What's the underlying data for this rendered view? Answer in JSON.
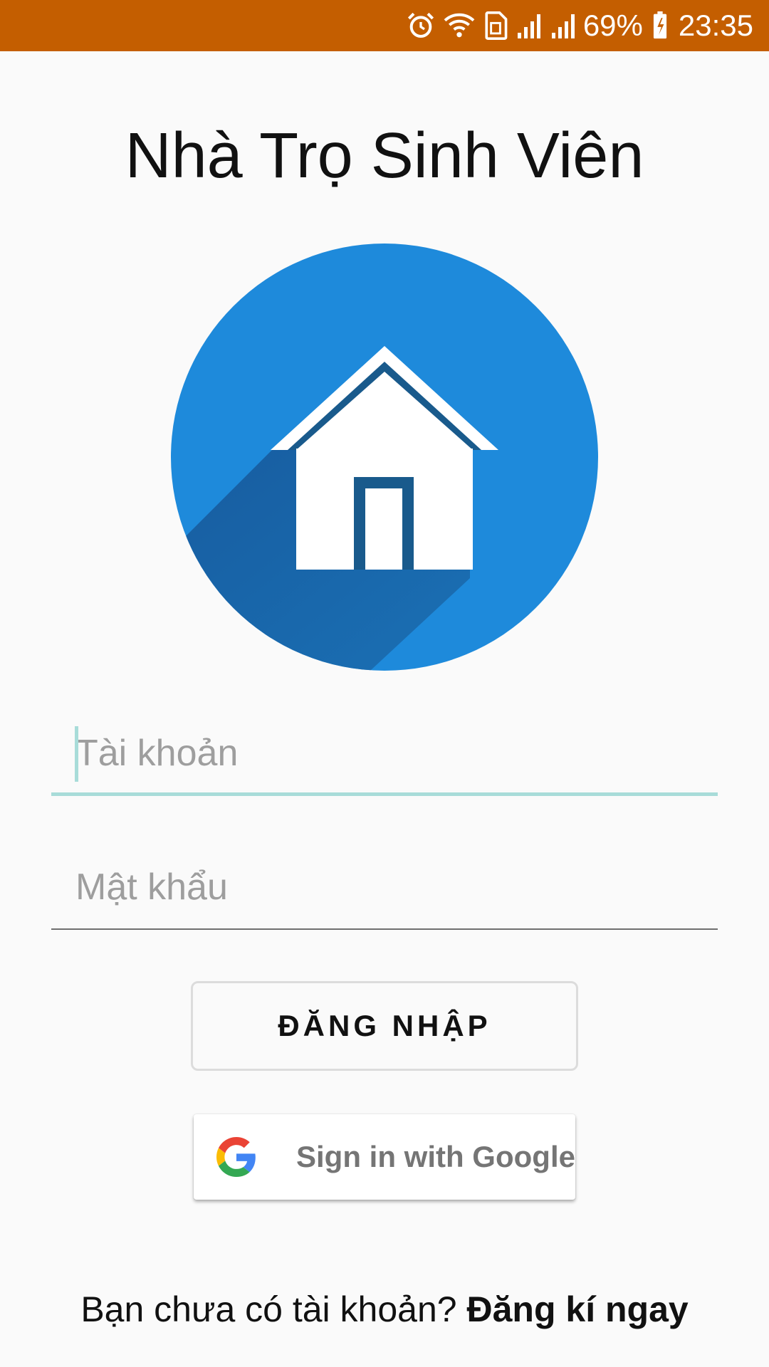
{
  "status_bar": {
    "battery_percent": "69%",
    "time": "23:35",
    "background_color": "#c45e00",
    "icons": [
      "alarm-icon",
      "wifi-icon",
      "sim-icon",
      "signal-1-icon",
      "signal-2-icon",
      "battery-charging-icon"
    ]
  },
  "app": {
    "title": "Nhà Trọ Sinh Viên",
    "logo_icon": "house-icon",
    "logo_color": "#1e8adb"
  },
  "form": {
    "username_placeholder": "Tài khoản",
    "username_value": "",
    "password_placeholder": "Mật khẩu",
    "password_value": "",
    "login_label": "ĐĂNG NHẬP",
    "google_label": "Sign in with Google",
    "focus_color": "#a8dcd9"
  },
  "signup": {
    "prompt": "Bạn chưa có tài khoản?",
    "link": "Đăng kí ngay"
  }
}
